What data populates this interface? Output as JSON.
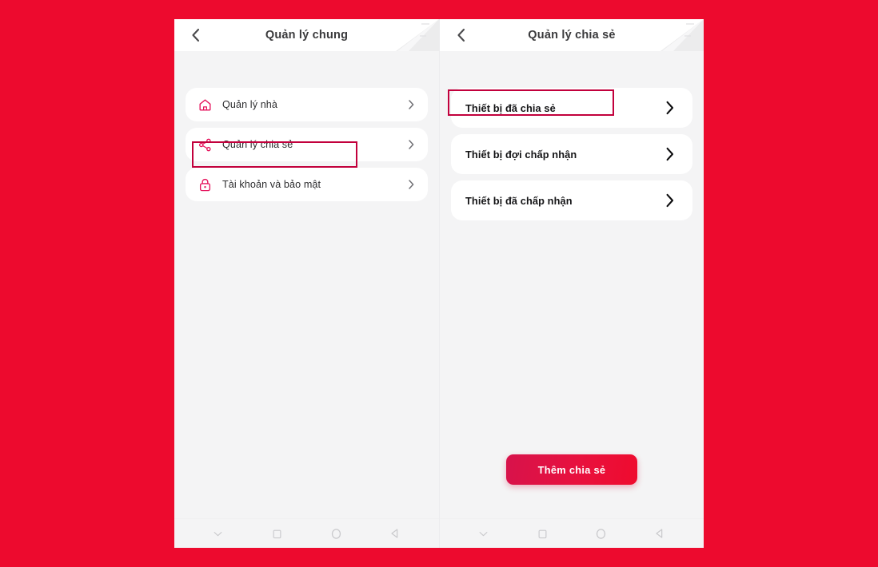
{
  "theme": {
    "background_red": "#ed0a2e",
    "panel_bg": "#f4f4f5",
    "card_bg": "#ffffff",
    "accent_pink": "#e5125b",
    "highlight_border": "#c2003c",
    "cta_gradient_from": "#d7124b",
    "cta_gradient_to": "#ef0b2e"
  },
  "left_screen": {
    "back_icon": "chevron-left-icon",
    "title": "Quản lý chung",
    "items": [
      {
        "icon": "home-icon",
        "label": "Quản lý nhà",
        "chevron": "chevron-right-icon",
        "highlighted": false
      },
      {
        "icon": "share-icon",
        "label": "Quản lý chia sẻ",
        "chevron": "chevron-right-icon",
        "highlighted": true
      },
      {
        "icon": "lock-icon",
        "label": "Tài khoản và bảo mật",
        "chevron": "chevron-right-icon",
        "highlighted": false
      }
    ]
  },
  "right_screen": {
    "back_icon": "chevron-left-icon",
    "title": "Quản lý chia sẻ",
    "items": [
      {
        "label": "Thiết bị đã chia sẻ",
        "chevron": "chevron-right-icon",
        "highlighted": true
      },
      {
        "label": "Thiết bị đợi chấp nhận",
        "chevron": "chevron-right-icon",
        "highlighted": false
      },
      {
        "label": "Thiết bị đã chấp nhận",
        "chevron": "chevron-right-icon",
        "highlighted": false
      }
    ],
    "cta_label": "Thêm chia sẻ"
  },
  "navbar": {
    "items": [
      {
        "icon": "chevron-down-icon"
      },
      {
        "icon": "square-icon"
      },
      {
        "icon": "circle-icon"
      },
      {
        "icon": "triangle-left-icon"
      }
    ]
  }
}
